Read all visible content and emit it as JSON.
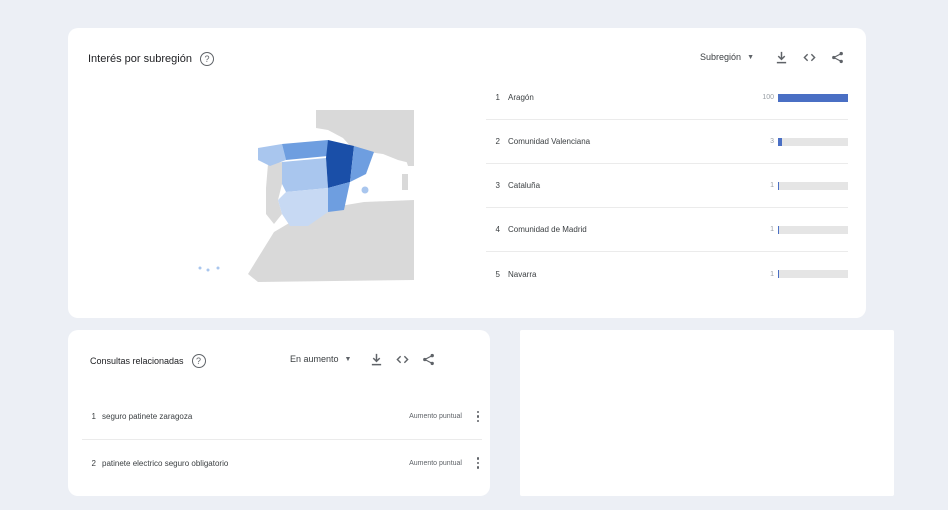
{
  "region_card": {
    "title": "Interés por subregión",
    "help_glyph": "?",
    "resolution_select": "Subregión",
    "regions": [
      {
        "rank": "1",
        "name": "Aragón",
        "value": "100",
        "level": 1.0
      },
      {
        "rank": "2",
        "name": "Comunidad Valenciana",
        "value": "3",
        "level": 0.06
      },
      {
        "rank": "3",
        "name": "Cataluña",
        "value": "1",
        "level": 0.02
      },
      {
        "rank": "4",
        "name": "Comunidad de Madrid",
        "value": "1",
        "level": 0.02
      },
      {
        "rank": "5",
        "name": "Navarra",
        "value": "1",
        "level": 0.02
      }
    ],
    "map_colors": {
      "highlight": "#1a4fa8",
      "mid": "#6e9ee0",
      "light": "#a9c6ee",
      "pale": "#c7d9f3",
      "land": "#d9d9d9"
    }
  },
  "queries_card": {
    "title": "Consultas relacionadas",
    "help_glyph": "?",
    "filter_select": "En aumento",
    "queries": [
      {
        "rank": "1",
        "text": "seguro patinete zaragoza",
        "badge": "Aumento puntual"
      },
      {
        "rank": "2",
        "text": "patinete electrico seguro obligatorio",
        "badge": "Aumento puntual"
      }
    ]
  },
  "icons": {
    "download": "download-icon",
    "embed": "embed-code-icon",
    "share": "share-icon",
    "more": "more-vert-icon",
    "caret": "▼"
  },
  "colors": {
    "accent_bar": "#4a6fc4",
    "page_bg": "#eceff5"
  }
}
